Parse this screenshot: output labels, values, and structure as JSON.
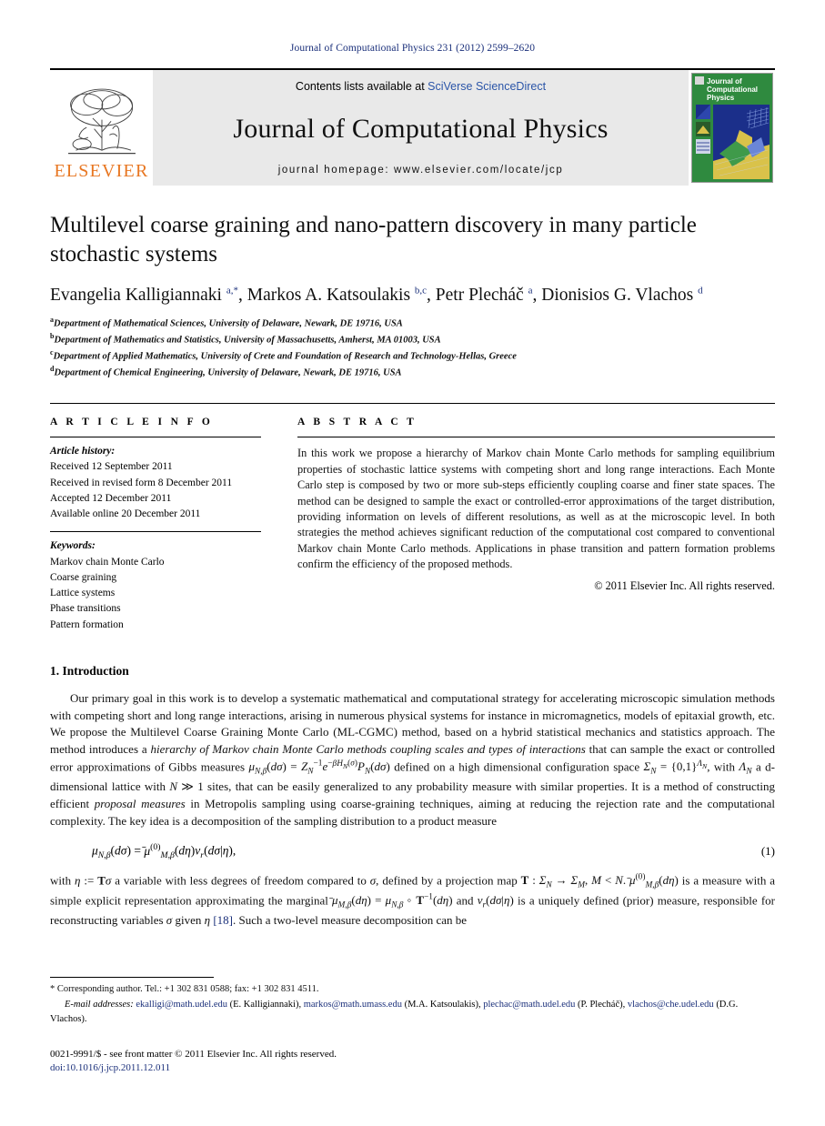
{
  "running_head": "Journal of Computational Physics 231 (2012) 2599–2620",
  "masthead": {
    "publisher_name": "ELSEVIER",
    "contents_prefix": "Contents lists available at",
    "contents_link": "SciVerse ScienceDirect",
    "journal_title": "Journal of Computational Physics",
    "homepage": "journal homepage: www.elsevier.com/locate/jcp",
    "cover_title_line1": "Journal of",
    "cover_title_line2": "Computational",
    "cover_title_line3": "Physics",
    "cover_border_color": "#2f8a3f",
    "cover_scene_color": "#1b2f8a"
  },
  "article": {
    "title": "Multilevel coarse graining and nano-pattern discovery in many particle stochastic systems",
    "authors_html": "Evangelia Kalligiannaki <sup>a,</sup><sup>*</sup>, Markos A. Katsoulakis <sup>b,c</sup>, Petr Plecháč <sup>a</sup>, Dionisios G. Vlachos <sup>d</sup>",
    "affiliations": [
      {
        "marker": "a",
        "text": "Department of Mathematical Sciences, University of Delaware, Newark, DE 19716, USA"
      },
      {
        "marker": "b",
        "text": "Department of Mathematics and Statistics, University of Massachusetts, Amherst, MA 01003, USA"
      },
      {
        "marker": "c",
        "text": "Department of Applied Mathematics, University of Crete and Foundation of Research and Technology-Hellas, Greece"
      },
      {
        "marker": "d",
        "text": "Department of Chemical Engineering, University of Delaware, Newark, DE 19716, USA"
      }
    ]
  },
  "article_info": {
    "heading": "A R T I C L E   I N F O",
    "history_heading": "Article history:",
    "history": [
      "Received 12 September 2011",
      "Received in revised form 8 December 2011",
      "Accepted 12 December 2011",
      "Available online 20 December 2011"
    ],
    "keywords_heading": "Keywords:",
    "keywords": [
      "Markov chain Monte Carlo",
      "Coarse graining",
      "Lattice systems",
      "Phase transitions",
      "Pattern formation"
    ]
  },
  "abstract": {
    "heading": "A B S T R A C T",
    "text": "In this work we propose a hierarchy of Markov chain Monte Carlo methods for sampling equilibrium properties of stochastic lattice systems with competing short and long range interactions. Each Monte Carlo step is composed by two or more sub-steps efficiently coupling coarse and finer state spaces. The method can be designed to sample the exact or controlled-error approximations of the target distribution, providing information on levels of different resolutions, as well as at the microscopic level. In both strategies the method achieves significant reduction of the computational cost compared to conventional Markov chain Monte Carlo methods. Applications in phase transition and pattern formation problems confirm the efficiency of the proposed methods.",
    "copyright": "© 2011 Elsevier Inc. All rights reserved."
  },
  "introduction": {
    "heading": "1. Introduction",
    "paragraph1_a": "Our primary goal in this work is to develop a systematic mathematical and computational strategy for accelerating microscopic simulation methods with competing short and long range interactions, arising in numerous physical systems for instance in micromagnetics, models of epitaxial growth, etc. We propose the Multilevel Coarse Graining Monte Carlo (ML-CGMC) method, based on a hybrid statistical mechanics and statistics approach. The method introduces a ",
    "paragraph1_italic": "hierarchy of Markov chain Monte Carlo methods coupling scales and types of interactions",
    "paragraph1_b": " that can sample the exact or controlled error approximations of Gibbs measures ",
    "paragraph1_c": " defined on a high dimensional configuration space ",
    "paragraph1_d": ", with ",
    "paragraph1_e": " a d-dimensional lattice with ",
    "paragraph1_f": " 1 sites, that can be easily generalized to any probability measure with similar properties. It is a method of constructing efficient ",
    "paragraph1_italic2": "proposal measures",
    "paragraph1_g": " in Metropolis sampling using coarse-graining techniques, aiming at reducing the rejection rate and the computational complexity. The key idea is a decomposition of the sampling distribution to a product measure",
    "equation_number": "(1)",
    "paragraph2_a": "with ",
    "paragraph2_b": " a variable with less degrees of freedom compared to ",
    "paragraph2_c": ", defined by a projection map ",
    "paragraph2_d": " is a measure with a simple explicit representation approximating the marginal ",
    "paragraph2_e": " and ",
    "paragraph2_f": " is a uniquely defined (prior) measure, responsible for reconstructing variables ",
    "paragraph2_g": " given ",
    "paragraph2_ref": "[18]",
    "paragraph2_h": ". Such a two-level measure decomposition can be"
  },
  "footer": {
    "corresponding": "* Corresponding author. Tel.: +1 302 831 0588; fax: +1 302 831 4511.",
    "emails_label": "E-mail addresses:",
    "emails": [
      {
        "address": "ekalligi@math.udel.edu",
        "person": "(E. Kalligiannaki)"
      },
      {
        "address": "markos@math.umass.edu",
        "person": "(M.A. Katsoulakis)"
      },
      {
        "address": "plechac@math.udel.edu",
        "person": "(P. Plecháč)"
      },
      {
        "address": "vlachos@che.udel.edu",
        "person": "(D.G. Vlachos)"
      }
    ],
    "issn_line": "0021-9991/$ - see front matter © 2011 Elsevier Inc. All rights reserved.",
    "doi": "doi:10.1016/j.jcp.2011.12.011"
  }
}
